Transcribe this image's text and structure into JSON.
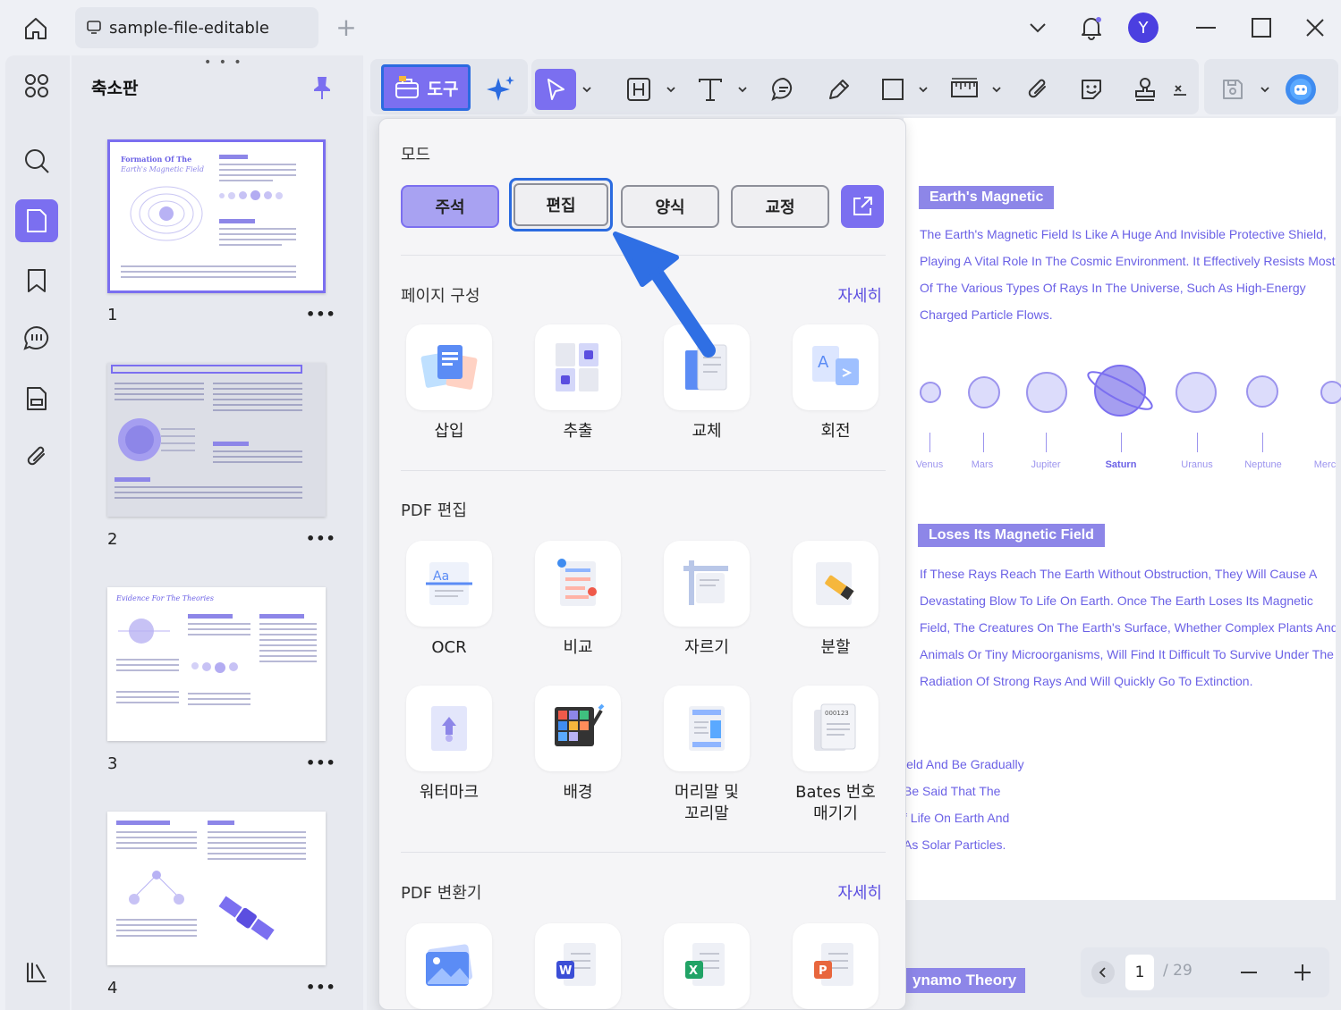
{
  "titlebar": {
    "file_tab_label": "sample-file-editable",
    "new_tab": "+",
    "avatar_letter": "Y"
  },
  "thumbnails": {
    "title": "축소판",
    "grip": "• • •",
    "more": "•••",
    "pages": [
      {
        "number": "1",
        "title_a": "Formation Of The",
        "title_b": "Earth's Magnetic Field"
      },
      {
        "number": "2"
      },
      {
        "number": "3",
        "title_a": "Evidence For The Theories"
      },
      {
        "number": "4"
      }
    ]
  },
  "toolbar": {
    "tool_label": "도구"
  },
  "panel": {
    "mode_title": "모드",
    "modes": [
      "주석",
      "편집",
      "양식",
      "교정"
    ],
    "page_section_title": "페이지 구성",
    "more_label": "자세히",
    "page_tools": [
      "삽입",
      "추출",
      "교체",
      "회전"
    ],
    "edit_section_title": "PDF 편집",
    "edit_tools": [
      "OCR",
      "비교",
      "자르기",
      "분할",
      "워터마크",
      "배경",
      "머리말 및\n꼬리말",
      "Bates 번호\n매기기"
    ],
    "convert_section_title": "PDF 변환기"
  },
  "document": {
    "heading1": "Earth's Magnetic",
    "para1": "The Earth's Magnetic Field Is Like A Huge And Invisible Protective Shield,\nPlaying A Vital Role In The Cosmic Environment. It Effectively Resists Most\nOf The Various Types Of Rays In The Universe, Such As High-Energy\nCharged Particle Flows.",
    "planets": [
      "Venus",
      "Mars",
      "Jupiter",
      "Saturn",
      "Uranus",
      "Neptune",
      "Merc"
    ],
    "heading2": "Loses Its Magnetic Field",
    "para2": "If These Rays Reach The Earth Without Obstruction, They Will Cause A\nDevastating Blow To Life On Earth. Once The Earth Loses Its Magnetic\nField, The Creatures On The Earth's Surface, Whether Complex Plants And\nAnimals Or Tiny Microorganisms, Will Find It Difficult To Survive Under The\nRadiation Of Strong Rays And Will Quickly Go To Extinction.",
    "para3": "ield And Be Gradually\nBe Said That The\nf Life On Earth And\nAs Solar Particles.",
    "heading3": "ynamo Theory"
  },
  "pager": {
    "current_page": "1",
    "total": "/ 29"
  },
  "colors": {
    "accent": "#7b6ff0",
    "focus_blue": "#2b6be0",
    "doc_text": "#6b61e6"
  }
}
